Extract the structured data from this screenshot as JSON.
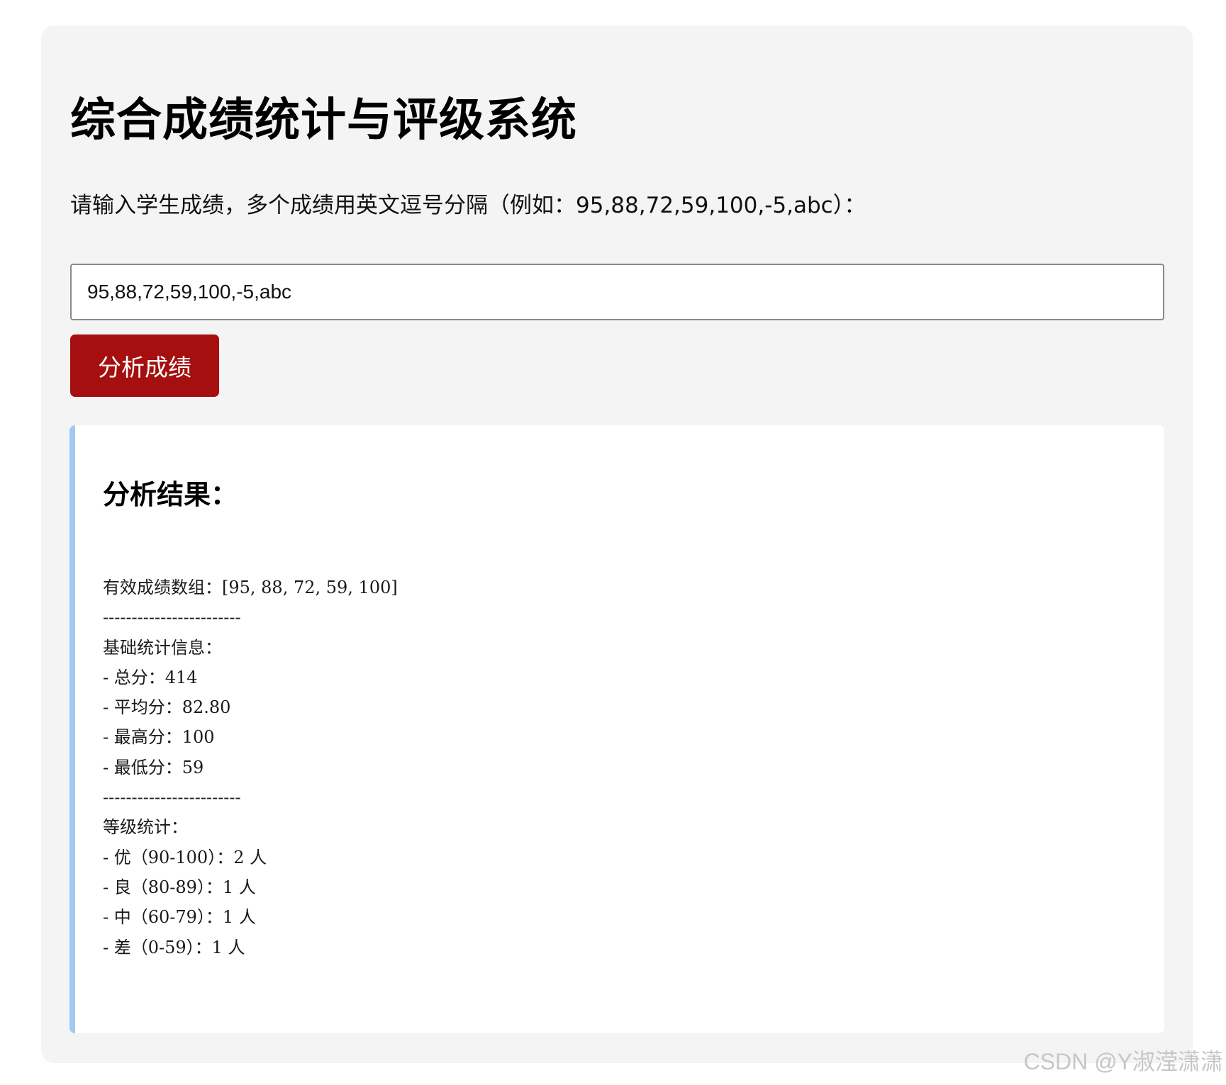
{
  "page": {
    "title": "综合成绩统计与评级系统",
    "prompt": "请输入学生成绩，多个成绩用英文逗号分隔（例如：95,88,72,59,100,-5,abc）："
  },
  "form": {
    "input_value": "95,88,72,59,100,-5,abc",
    "analyze_button_label": "分析成绩"
  },
  "result": {
    "title": "分析结果：",
    "valid_array_line": "有效成绩数组：[95, 88, 72, 59, 100]",
    "divider": "------------------------",
    "basic_heading": "基础统计信息：",
    "total_line": "- 总分：414",
    "average_line": "- 平均分：82.80",
    "max_line": "- 最高分：100",
    "min_line": "- 最低分：59",
    "grade_heading": "等级统计：",
    "grade_excellent_line": "- 优（90-100）：2 人",
    "grade_good_line": "- 良（80-89）：1 人",
    "grade_medium_line": "- 中（60-79）：1 人",
    "grade_poor_line": "- 差（0-59）：1 人"
  },
  "watermark": "CSDN @Y淑滢潇潇",
  "colors": {
    "card_background": "#f4f4f4",
    "button_background": "#a50f0f",
    "result_accent_border": "#9fc8f2"
  }
}
